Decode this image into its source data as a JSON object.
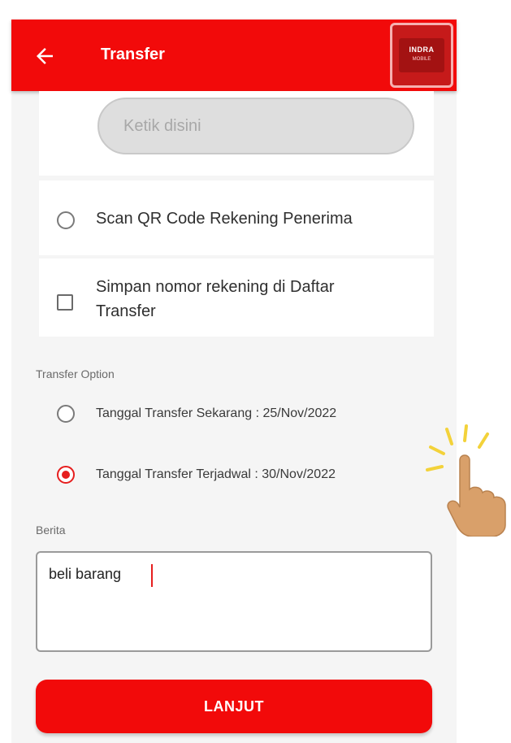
{
  "appbar": {
    "title": "Transfer",
    "back_icon": "arrow-left-icon",
    "brand_line1": "INDRA",
    "brand_line2": "MOBILE"
  },
  "search": {
    "placeholder": "Ketik disini"
  },
  "options": {
    "scan_qr_label": "Scan QR Code Rekening Penerima",
    "save_account_label": "Simpan nomor rekening di Daftar Transfer",
    "save_account_line1": "Simpan nomor rekening di Daftar",
    "save_account_line2": "Transfer"
  },
  "transfer_option": {
    "section_label": "Transfer Option",
    "now_label": "Tanggal Transfer Sekarang : 25/Nov/2022",
    "scheduled_label": "Tanggal Transfer Terjadwal : 30/Nov/2022",
    "selected": "scheduled"
  },
  "berita": {
    "section_label": "Berita",
    "value": "beli barang"
  },
  "actions": {
    "submit_label": "LANJUT"
  },
  "colors": {
    "brand_red": "#f20a0a",
    "radio_selected": "#e61e1e",
    "hand_skin": "#d9a06a",
    "sparkle": "#f3d23a"
  },
  "icons": {
    "pointer": "tap-hand-icon"
  }
}
